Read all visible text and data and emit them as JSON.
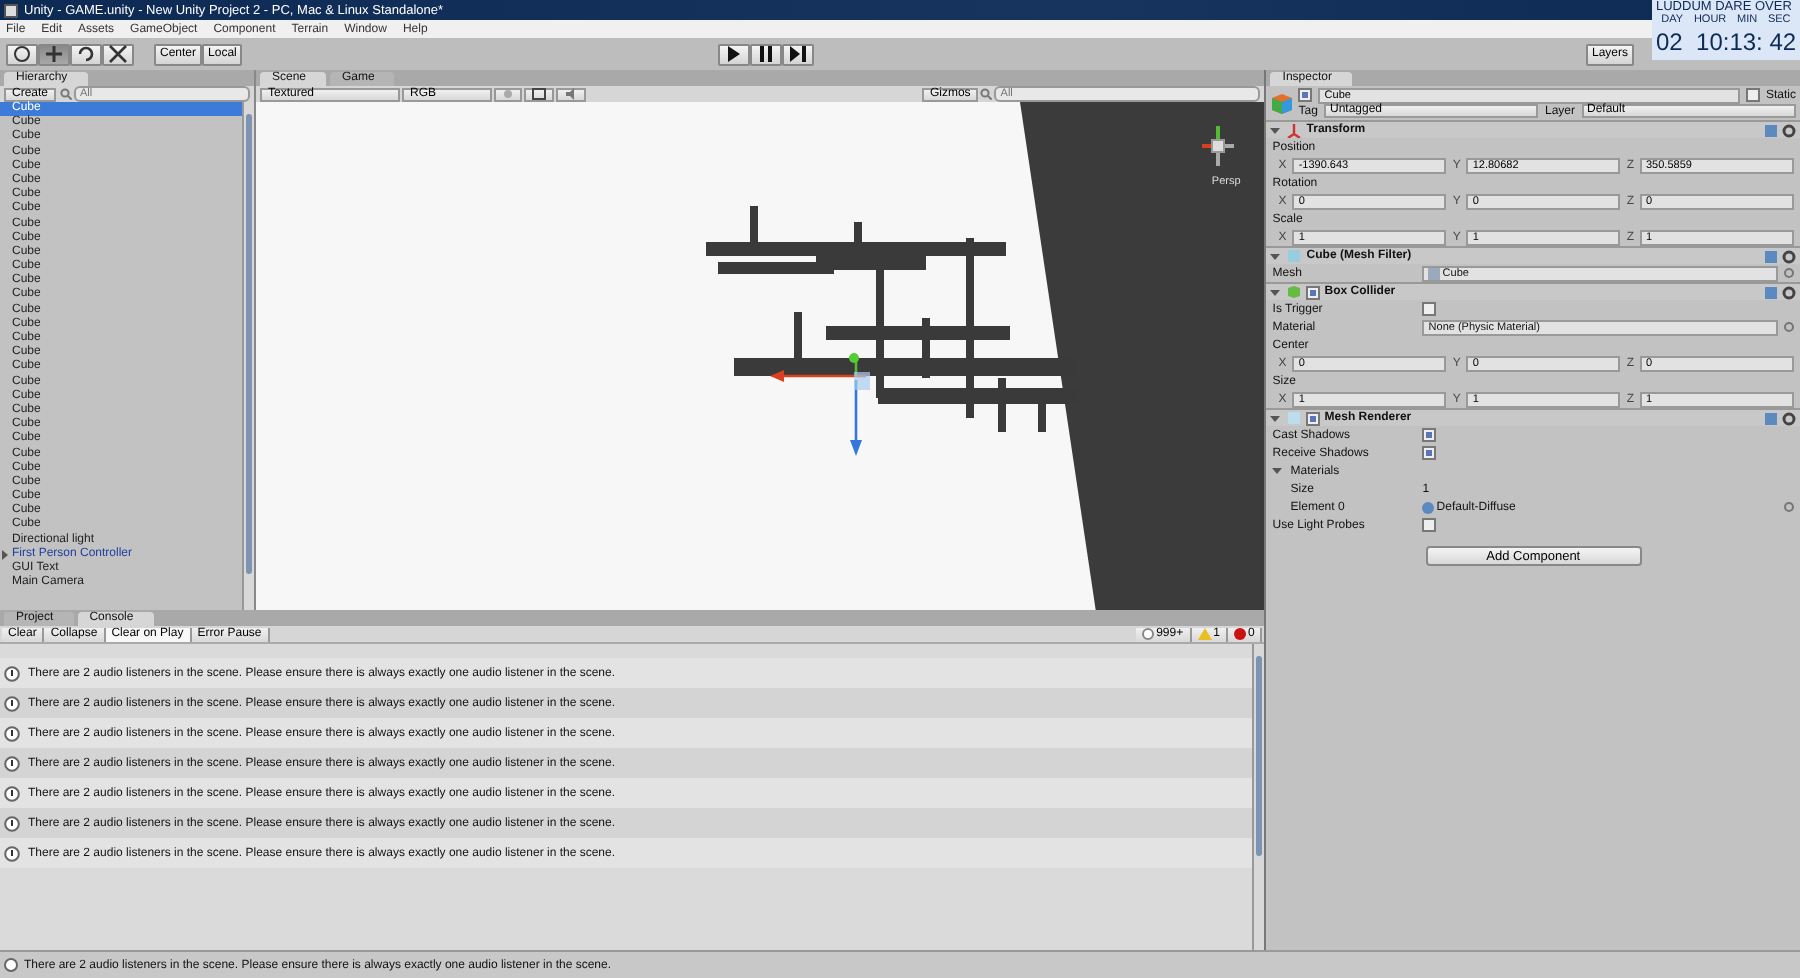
{
  "window": {
    "title": "Unity - GAME.unity - New Unity Project 2 - PC, Mac & Linux Standalone*"
  },
  "menu": [
    "File",
    "Edit",
    "Assets",
    "GameObject",
    "Component",
    "Terrain",
    "Window",
    "Help"
  ],
  "toolbar": {
    "tools": [
      {
        "kind": "hand",
        "selected": false
      },
      {
        "kind": "move",
        "selected": true
      },
      {
        "kind": "rotate",
        "selected": false
      },
      {
        "kind": "scale",
        "selected": false
      }
    ],
    "pivot": [
      "Center",
      "Local"
    ],
    "layers": "Layers"
  },
  "countdown": {
    "title": "LUDDUM DARE OVER",
    "labels": [
      "DAY",
      "HOUR",
      "MIN",
      "SEC"
    ],
    "value": "02  10:13: 42"
  },
  "hierarchy": {
    "tab": "Hierarchy",
    "create": "Create",
    "search_placeholder": "All",
    "items": [
      {
        "label": "Cube",
        "kind": "object",
        "selected": true
      },
      {
        "label": "Cube",
        "kind": "object",
        "selected": false
      },
      {
        "label": "Cube",
        "kind": "object",
        "selected": false
      },
      {
        "label": "Cube",
        "kind": "object",
        "selected": false
      },
      {
        "label": "Cube",
        "kind": "object",
        "selected": false
      },
      {
        "label": "Cube",
        "kind": "object",
        "selected": false
      },
      {
        "label": "Cube",
        "kind": "object",
        "selected": false
      },
      {
        "label": "Cube",
        "kind": "object",
        "selected": false
      },
      {
        "label": "Cube",
        "kind": "object",
        "selected": false
      },
      {
        "label": "Cube",
        "kind": "object",
        "selected": false
      },
      {
        "label": "Cube",
        "kind": "object",
        "selected": false
      },
      {
        "label": "Cube",
        "kind": "object",
        "selected": false
      },
      {
        "label": "Cube",
        "kind": "object",
        "selected": false
      },
      {
        "label": "Cube",
        "kind": "object",
        "selected": false
      },
      {
        "label": "Cube",
        "kind": "object",
        "selected": false
      },
      {
        "label": "Cube",
        "kind": "object",
        "selected": false
      },
      {
        "label": "Cube",
        "kind": "object",
        "selected": false
      },
      {
        "label": "Cube",
        "kind": "object",
        "selected": false
      },
      {
        "label": "Cube",
        "kind": "object",
        "selected": false
      },
      {
        "label": "Cube",
        "kind": "object",
        "selected": false
      },
      {
        "label": "Cube",
        "kind": "object",
        "selected": false
      },
      {
        "label": "Cube",
        "kind": "object",
        "selected": false
      },
      {
        "label": "Cube",
        "kind": "object",
        "selected": false
      },
      {
        "label": "Cube",
        "kind": "object",
        "selected": false
      },
      {
        "label": "Cube",
        "kind": "object",
        "selected": false
      },
      {
        "label": "Cube",
        "kind": "object",
        "selected": false
      },
      {
        "label": "Cube",
        "kind": "object",
        "selected": false
      },
      {
        "label": "Cube",
        "kind": "object",
        "selected": false
      },
      {
        "label": "Cube",
        "kind": "object",
        "selected": false
      },
      {
        "label": "Cube",
        "kind": "object",
        "selected": false
      },
      {
        "label": "Directional light",
        "kind": "object",
        "selected": false
      },
      {
        "label": "First Person Controller",
        "kind": "prefab",
        "selected": false,
        "expanded": false
      },
      {
        "label": "GUI Text",
        "kind": "object",
        "selected": false
      },
      {
        "label": "Main Camera",
        "kind": "object",
        "selected": false
      }
    ]
  },
  "scene": {
    "tabs": [
      {
        "label": "Scene",
        "selected": true
      },
      {
        "label": "Game",
        "selected": false
      }
    ],
    "shading": "Textured",
    "render_mode": "RGB",
    "gizmos": "Gizmos",
    "search_placeholder": "All",
    "view_label": "Persp"
  },
  "inspector": {
    "tab": "Inspector",
    "object_name": "Cube",
    "active": true,
    "static_label": "Static",
    "static": false,
    "tag_label": "Tag",
    "tag": "Untagged",
    "layer_label": "Layer",
    "layer": "Default",
    "components": [
      {
        "title": "Transform",
        "kind": "transform",
        "rows": [
          {
            "kind": "header",
            "label": "Position"
          },
          {
            "kind": "vector",
            "fields": [
              {
                "axis": "X",
                "value": "-1390.643"
              },
              {
                "axis": "Y",
                "value": "12.80682"
              },
              {
                "axis": "Z",
                "value": "350.5859"
              }
            ]
          },
          {
            "kind": "header",
            "label": "Rotation"
          },
          {
            "kind": "vector",
            "fields": [
              {
                "axis": "X",
                "value": "0"
              },
              {
                "axis": "Y",
                "value": "0"
              },
              {
                "axis": "Z",
                "value": "0"
              }
            ]
          },
          {
            "kind": "header",
            "label": "Scale"
          },
          {
            "kind": "vector",
            "fields": [
              {
                "axis": "X",
                "value": "1"
              },
              {
                "axis": "Y",
                "value": "1"
              },
              {
                "axis": "Z",
                "value": "1"
              }
            ]
          }
        ]
      },
      {
        "title": "Cube (Mesh Filter)",
        "kind": "mesh_filter",
        "rows": [
          {
            "kind": "object",
            "label": "Mesh",
            "value": "Cube"
          }
        ]
      },
      {
        "title": "Box Collider",
        "kind": "collider",
        "enabled": true,
        "rows": [
          {
            "kind": "checkbox",
            "label": "Is Trigger",
            "checked": false
          },
          {
            "kind": "object",
            "label": "Material",
            "value": "None (Physic Material)"
          },
          {
            "kind": "header",
            "label": "Center"
          },
          {
            "kind": "vector",
            "fields": [
              {
                "axis": "X",
                "value": "0"
              },
              {
                "axis": "Y",
                "value": "0"
              },
              {
                "axis": "Z",
                "value": "0"
              }
            ]
          },
          {
            "kind": "header",
            "label": "Size"
          },
          {
            "kind": "vector",
            "fields": [
              {
                "axis": "X",
                "value": "1"
              },
              {
                "axis": "Y",
                "value": "1"
              },
              {
                "axis": "Z",
                "value": "1"
              }
            ]
          }
        ]
      },
      {
        "title": "Mesh Renderer",
        "kind": "renderer",
        "enabled": true,
        "rows": [
          {
            "kind": "checkbox",
            "label": "Cast Shadows",
            "checked": true
          },
          {
            "kind": "checkbox",
            "label": "Receive Shadows",
            "checked": true
          },
          {
            "kind": "foldout",
            "label": "Materials",
            "expanded": true,
            "children": [
              {
                "kind": "value",
                "label": "Size",
                "value": "1"
              },
              {
                "kind": "material",
                "label": "Element 0",
                "value": "Default-Diffuse"
              }
            ]
          },
          {
            "kind": "checkbox",
            "label": "Use Light Probes",
            "checked": false
          }
        ]
      }
    ],
    "add_button": "Add Component"
  },
  "console": {
    "tabs": [
      {
        "label": "Project",
        "selected": false
      },
      {
        "label": "Console",
        "selected": true
      }
    ],
    "buttons": [
      {
        "label": "Clear",
        "on": false
      },
      {
        "label": "Collapse",
        "on": false
      },
      {
        "label": "Clear on Play",
        "on": true
      },
      {
        "label": "Error Pause",
        "on": false
      }
    ],
    "counts": {
      "info": "999+",
      "warnings": "1",
      "errors": "0"
    },
    "messages": [
      "There are 2 audio listeners in the scene. Please ensure there is always exactly one audio listener in the scene.",
      "There are 2 audio listeners in the scene. Please ensure there is always exactly one audio listener in the scene.",
      "There are 2 audio listeners in the scene. Please ensure there is always exactly one audio listener in the scene.",
      "There are 2 audio listeners in the scene. Please ensure there is always exactly one audio listener in the scene.",
      "There are 2 audio listeners in the scene. Please ensure there is always exactly one audio listener in the scene.",
      "There are 2 audio listeners in the scene. Please ensure there is always exactly one audio listener in the scene.",
      "There are 2 audio listeners in the scene. Please ensure there is always exactly one audio listener in the scene."
    ]
  },
  "status_bar": "There are 2 audio listeners in the scene. Please ensure there is always exactly one audio listener in the scene."
}
